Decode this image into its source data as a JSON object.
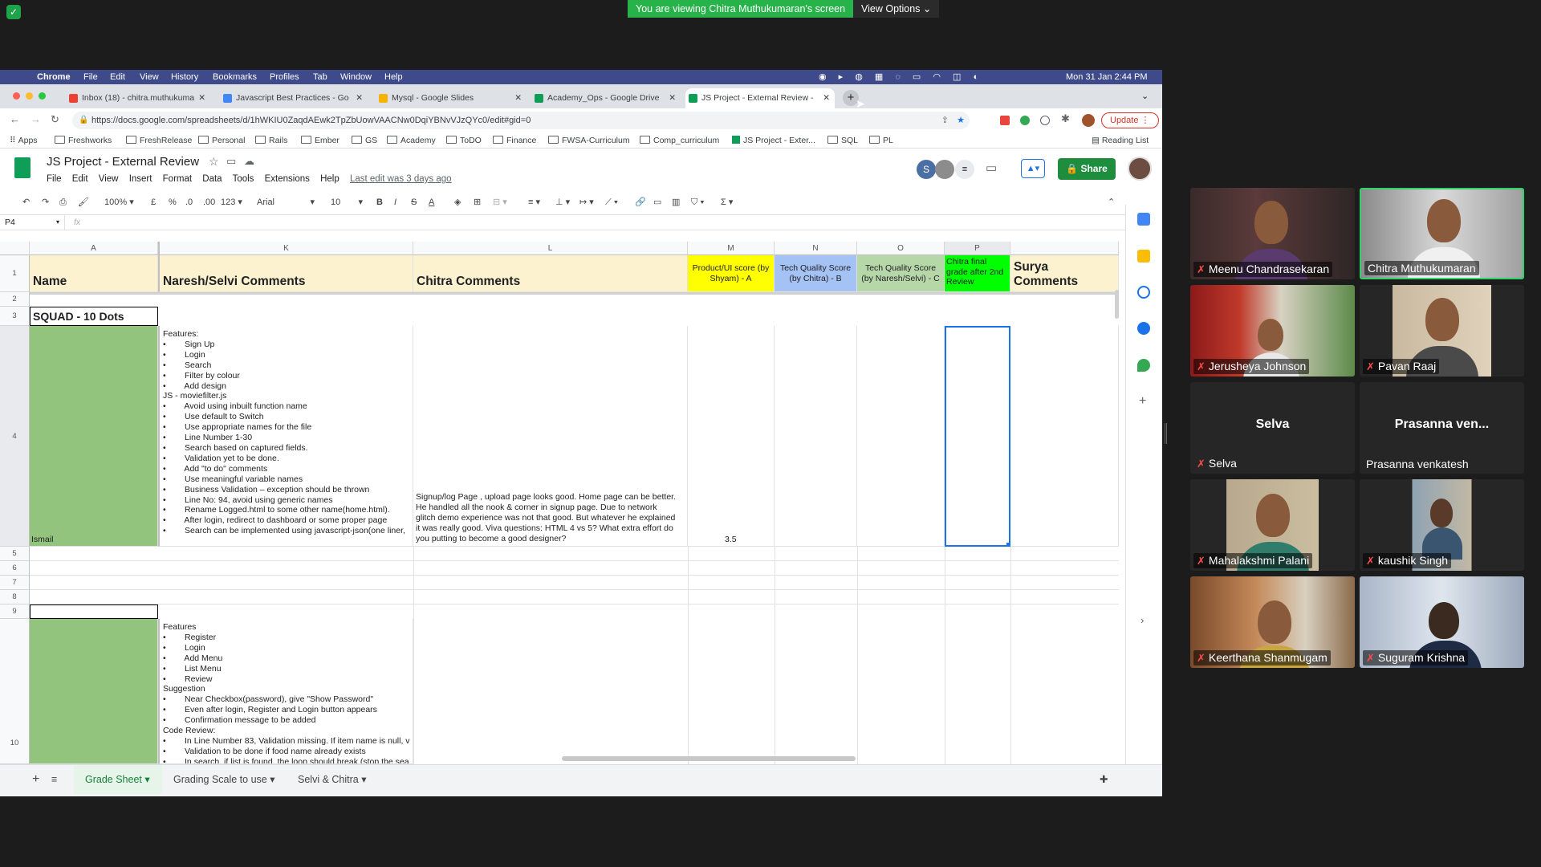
{
  "zoom": {
    "banner": "You are viewing Chitra Muthukumaran's screen",
    "view_options": "View Options"
  },
  "mac_menu": {
    "app": "Chrome",
    "items": [
      "File",
      "Edit",
      "View",
      "History",
      "Bookmarks",
      "Profiles",
      "Tab",
      "Window",
      "Help"
    ],
    "clock": "Mon 31 Jan  2:44 PM"
  },
  "tabs": [
    {
      "label": "Inbox (18) - chitra.muthukuma",
      "color": "#ea4335"
    },
    {
      "label": "Javascript Best Practices - Go",
      "color": "#4285f4"
    },
    {
      "label": "Mysql - Google Slides",
      "color": "#f4b400"
    },
    {
      "label": "Academy_Ops - Google Drive",
      "color": "#0f9d58"
    },
    {
      "label": "JS Project - External Review -",
      "color": "#0f9d58"
    }
  ],
  "url": "https://docs.google.com/spreadsheets/d/1hWKIU0ZaqdAEwk2TpZbUowVAACNw0DqiYBNvVJzQYc0/edit#gid=0",
  "update_label": "Update",
  "bookmarks": [
    "Apps",
    "Freshworks",
    "FreshRelease",
    "Personal",
    "Rails",
    "Ember",
    "GS",
    "Academy",
    "ToDO",
    "Finance",
    "FWSA-Curriculum",
    "Comp_curriculum",
    "JS Project - Exter...",
    "SQL",
    "PL"
  ],
  "reading_list": "Reading List",
  "doc": {
    "title": "JS Project - External Review",
    "menus": [
      "File",
      "Edit",
      "View",
      "Insert",
      "Format",
      "Data",
      "Tools",
      "Extensions",
      "Help"
    ],
    "last_edit": "Last edit was 3 days ago",
    "share": "Share"
  },
  "toolbar": {
    "zoom": "100%",
    "currency": "£",
    "percent": "%",
    "dec1": ".0",
    "dec2": ".00",
    "format": "123",
    "font": "Arial",
    "size": "10"
  },
  "name_box": "P4",
  "fx": "fx",
  "grid": {
    "columns": [
      "A",
      "K",
      "L",
      "M",
      "N",
      "O",
      "P"
    ],
    "rows": [
      "1",
      "2",
      "3",
      "4",
      "5",
      "6",
      "7",
      "8",
      "9",
      "10"
    ],
    "headers": {
      "name": "Name",
      "naresh": "Naresh/Selvi Comments",
      "chitra": "Chitra Comments",
      "m": "Product/UI score (by Shyam) - A",
      "n": "Tech Quality Score (by Chitra) - B",
      "o": "Tech Quality Score (by Naresh/Selvi) - C",
      "p": "Chitra final grade after 2nd Review",
      "surya": "Surya Comments"
    },
    "squad": "SQUAD - 10 Dots",
    "row4_name": "Ismail",
    "row4_naresh": "Features:\n•        Sign Up\n•        Login\n•        Search\n•        Filter by colour\n•        Add design\nJS - moviefilter.js\n•        Avoid using inbuilt function name\n•        Use default to Switch\n•        Use appropriate names for the file\n•        Line Number 1-30\n•        Search based on captured fields.\n•        Validation yet to be done.\n•        Add \"to do\" comments\n•        Use meaningful variable names\n•        Business Validation – exception should be thrown\n•        Line No: 94, avoid using generic names\n•        Rename Logged.html to some other name(home.html).\n•        After login, redirect to dashboard or some proper page\n•        Search can be implemented using javascript-json(one liner,",
    "row4_chitra": "Signup/log Page , upload page looks good. Home page can be better.\nHe handled all the nook & corner in signup page. Due to network\nglitch demo experience was not that good. But whatever he explained\nit was really good. Viva questions: HTML 4 vs 5? What extra effort do\nyou putting to become a good designer?",
    "row4_m": "3.5",
    "row10_naresh": "Features\n•        Register\n•        Login\n•        Add Menu\n•        List Menu\n•        Review\nSuggestion\n•        Near Checkbox(password), give \"Show Password\"\n•        Even after login, Register and Login button appears\n•        Confirmation message to be added\nCode Review:\n•        In Line Number 83, Validation missing. If item name is null, v\n•        Validation to be done if food name already exists\n•        In search, if list is found, the loop should break (stop the sea"
  },
  "sheet_tabs": [
    "Grade Sheet",
    "Grading Scale to use",
    "Selvi & Chitra"
  ],
  "participants": [
    {
      "name": "Meenu Chandrasekaran",
      "muted": true,
      "video": true,
      "active": false
    },
    {
      "name": "Chitra Muthukumaran",
      "muted": false,
      "video": true,
      "active": true
    },
    {
      "name": "Jerusheya Johnson",
      "muted": true,
      "video": true,
      "active": false
    },
    {
      "name": "Pavan Raaj",
      "muted": true,
      "video": true,
      "active": false
    },
    {
      "name": "Selva",
      "display": "Selva",
      "muted": true,
      "video": false,
      "active": false
    },
    {
      "name": "Prasanna venkatesh",
      "display": "Prasanna ven...",
      "muted": false,
      "video": false,
      "active": false
    },
    {
      "name": "Mahalakshmi Palani",
      "muted": true,
      "video": true,
      "active": false
    },
    {
      "name": "kaushik Singh",
      "muted": true,
      "video": true,
      "active": false
    },
    {
      "name": "Keerthana Shanmugam",
      "muted": true,
      "video": true,
      "active": false
    },
    {
      "name": "Suguram Krishna",
      "muted": true,
      "video": true,
      "active": false
    }
  ]
}
